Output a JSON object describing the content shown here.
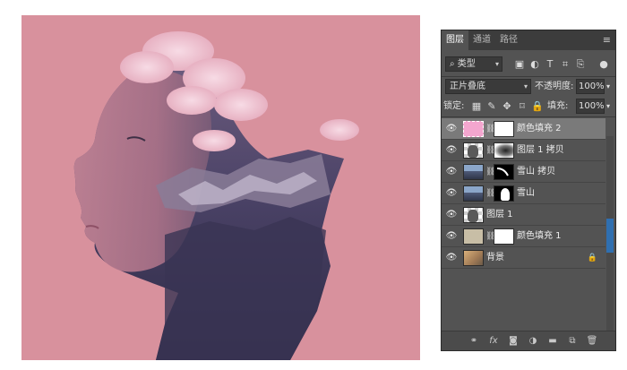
{
  "tabs": [
    "图层",
    "通道",
    "路径"
  ],
  "filter": {
    "label": "类型"
  },
  "blend_mode": "正片叠底",
  "opacity": {
    "label": "不透明度:",
    "value": "100%"
  },
  "lock": {
    "label": "锁定:"
  },
  "fill": {
    "label": "填充:",
    "value": "100%"
  },
  "layers": [
    {
      "name": "颜色填充 2",
      "selected": true,
      "thumb": "pink-color-fill",
      "mask": "white",
      "thumb_color": "#f3a6cf"
    },
    {
      "name": "图层 1 拷贝",
      "selected": false,
      "thumb": "portrait",
      "mask": "mountain-soft"
    },
    {
      "name": "雪山 拷贝",
      "selected": false,
      "thumb": "mountains",
      "mask": "snow-curve"
    },
    {
      "name": "雪山",
      "selected": false,
      "thumb": "mountains",
      "mask": "profile-white"
    },
    {
      "name": "图层 1",
      "selected": false,
      "thumb": "portrait",
      "mask": ""
    },
    {
      "name": "颜色填充 1",
      "selected": false,
      "thumb": "beige-color-fill",
      "mask": "white",
      "thumb_color": "#c8bea6"
    },
    {
      "name": "背景",
      "selected": false,
      "thumb": "background-photo",
      "mask": "",
      "locked": true
    }
  ],
  "colors": {
    "canvas_bg": "#d8919d",
    "panel_bg": "#535353",
    "selected_row": "#7a7a7a",
    "silhouette": "#3d3859"
  },
  "icons": {
    "panel_menu": "menu-icon",
    "bottom_bar": [
      "link-icon",
      "fx-icon",
      "mask-icon",
      "adjustment-icon",
      "folder-icon",
      "new-layer-icon",
      "trash-icon"
    ]
  }
}
